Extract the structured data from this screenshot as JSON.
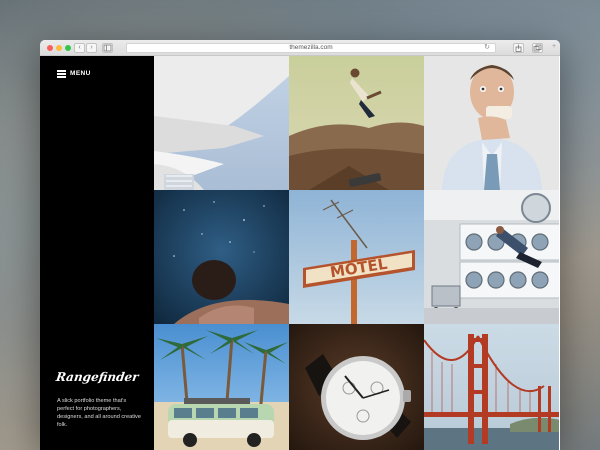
{
  "browser": {
    "url": "themezilla.com",
    "back_symbol": "‹",
    "forward_symbol": "›"
  },
  "site": {
    "menu_label": "MENU",
    "brand": "Rangefinder",
    "tagline": "A slick portfolio theme that's perfect for photographers, designers, and all around creative folk."
  },
  "motel_sign": "MOTEL",
  "portfolio": [
    {
      "subject": "white curved architecture"
    },
    {
      "subject": "jumping person in desert"
    },
    {
      "subject": "man eating sandwich"
    },
    {
      "subject": "underwater swimmer"
    },
    {
      "subject": "motel sign"
    },
    {
      "subject": "laundromat flying man"
    },
    {
      "subject": "palm trees and VW bus"
    },
    {
      "subject": "wrist watch"
    },
    {
      "subject": "golden gate bridge"
    }
  ],
  "colors": {
    "sidebar": "#000000",
    "traffic_red": "#fc605b",
    "traffic_yellow": "#fdbc40",
    "traffic_green": "#34c84a"
  }
}
